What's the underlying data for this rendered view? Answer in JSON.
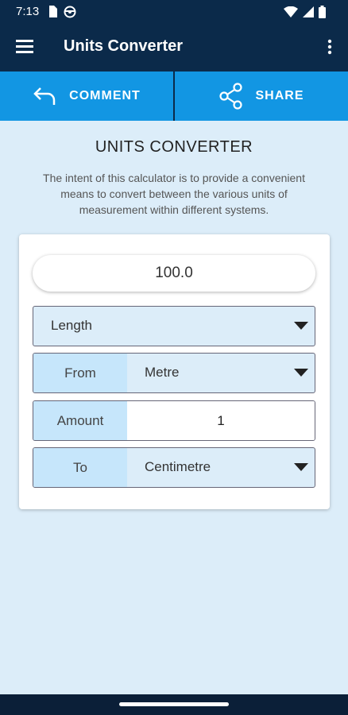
{
  "status": {
    "time": "7:13"
  },
  "appbar": {
    "title": "Units Converter"
  },
  "actions": {
    "comment_label": "COMMENT",
    "share_label": "SHARE"
  },
  "main": {
    "heading": "UNITS CONVERTER",
    "description": "The intent of this calculator is to provide a convenient means to convert between the various units of measurement within different systems."
  },
  "converter": {
    "result": "100.0",
    "category": "Length",
    "from_label": "From",
    "from_value": "Metre",
    "amount_label": "Amount",
    "amount_value": "1",
    "to_label": "To",
    "to_value": "Centimetre"
  },
  "colors": {
    "appbar": "#0b2a4a",
    "action_bar": "#1296e3",
    "background": "#dcedf9",
    "label_bg": "#c6e6fb"
  },
  "icons": [
    "menu-icon",
    "overflow-icon",
    "reply-icon",
    "share-icon",
    "dropdown-arrow-icon",
    "wifi-icon",
    "battery-icon",
    "signal-icon"
  ]
}
